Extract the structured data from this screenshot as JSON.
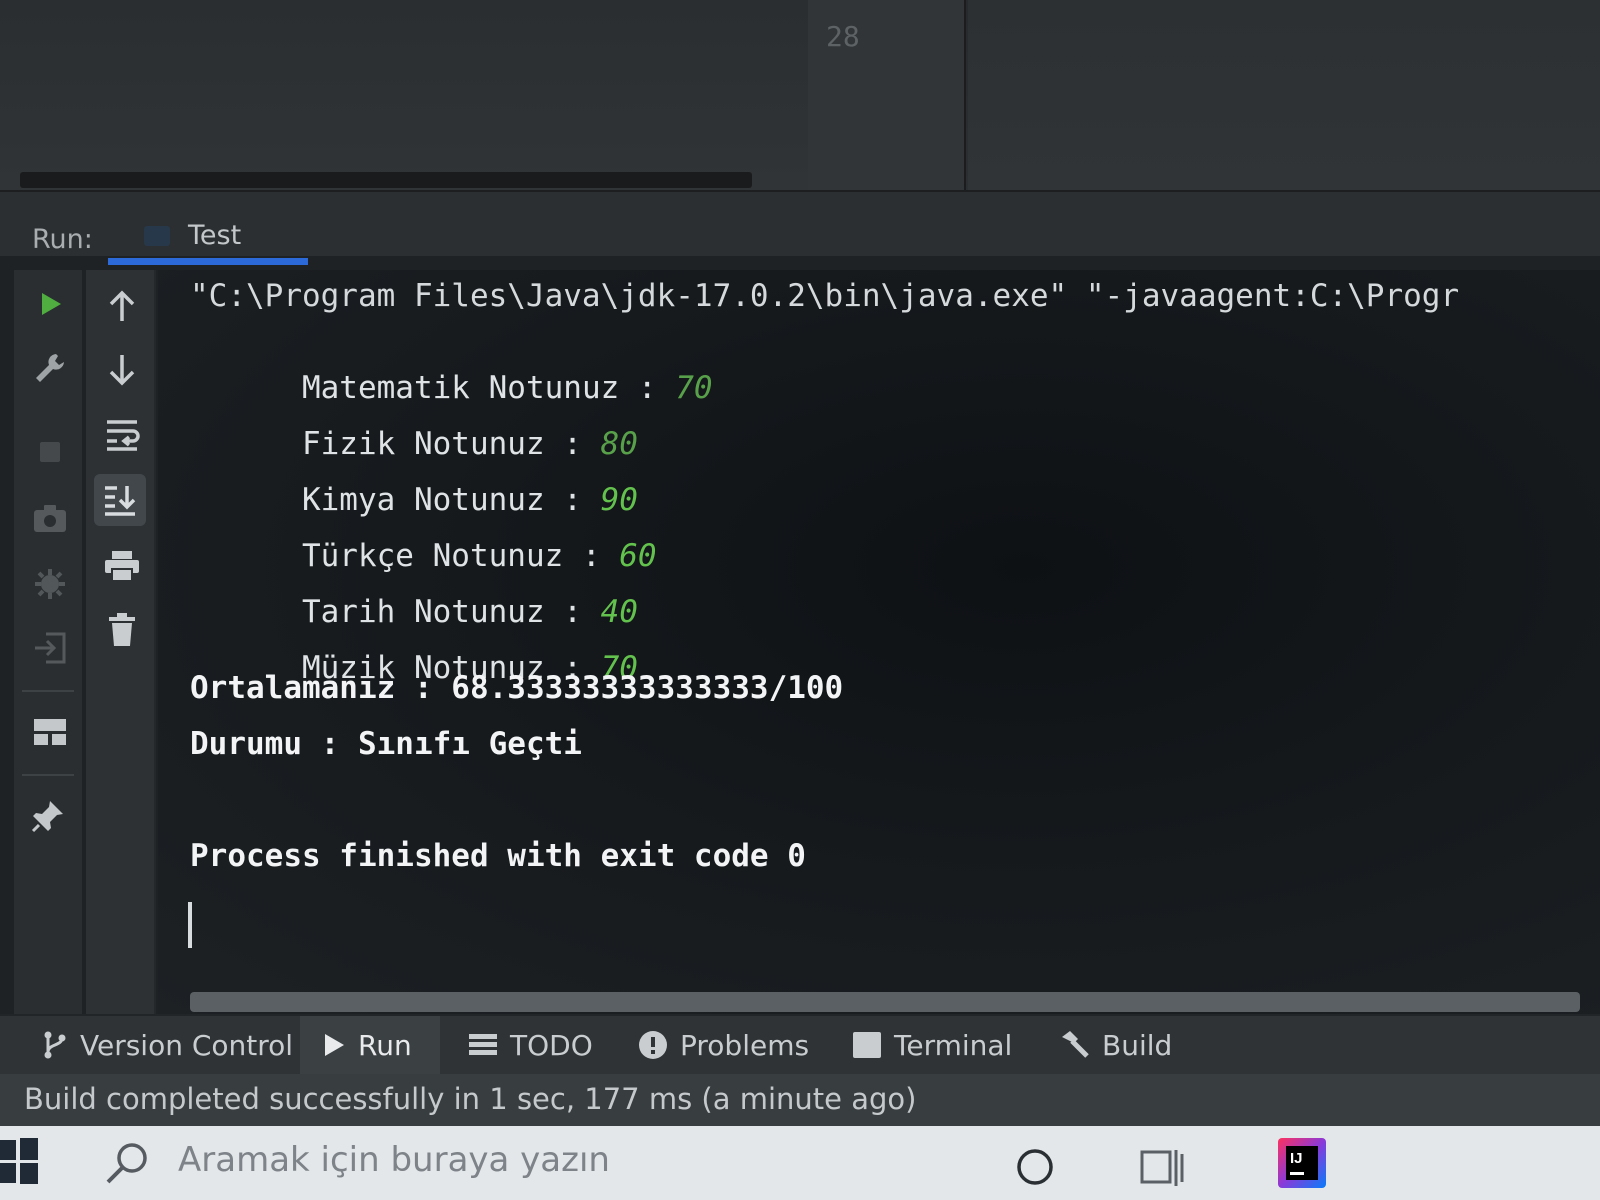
{
  "editor": {
    "line_number": "28"
  },
  "run_panel": {
    "label": "Run:",
    "tab_label": "Test"
  },
  "console": {
    "command_line": "\"C:\\Program Files\\Java\\jdk-17.0.2\\bin\\java.exe\" \"-javaagent:C:\\Progr",
    "prompts": [
      {
        "label": "Matematik Notunuz : ",
        "value": "70"
      },
      {
        "label": "Fizik Notunuz : ",
        "value": "80"
      },
      {
        "label": "Kimya Notunuz : ",
        "value": "90"
      },
      {
        "label": "Türkçe Notunuz : ",
        "value": "60"
      },
      {
        "label": "Tarih Notunuz : ",
        "value": "40"
      },
      {
        "label": "Müzik Notunuz : ",
        "value": "70"
      }
    ],
    "average_line": "Ortalamanız : 68.33333333333333/100",
    "status_line": "Durumu : Sınıfı Geçti",
    "exit_line": "Process finished with exit code 0",
    "input_color": "#63c24d"
  },
  "tool_strip": {
    "items": [
      {
        "label": "Version Control",
        "icon": "branch-icon"
      },
      {
        "label": "Run",
        "icon": "play-icon"
      },
      {
        "label": "TODO",
        "icon": "list-icon"
      },
      {
        "label": "Problems",
        "icon": "info-icon"
      },
      {
        "label": "Terminal",
        "icon": "terminal-icon"
      },
      {
        "label": "Build",
        "icon": "hammer-icon"
      }
    ]
  },
  "status_bar": {
    "text": "Build completed successfully in 1 sec, 177 ms (a minute ago)"
  },
  "taskbar": {
    "search_placeholder": "Aramak için buraya yazın",
    "app_badge": "IJ"
  },
  "colors": {
    "accent": "#2d6ad9",
    "run_green": "#4fae3f",
    "console_bg": "#111417"
  }
}
